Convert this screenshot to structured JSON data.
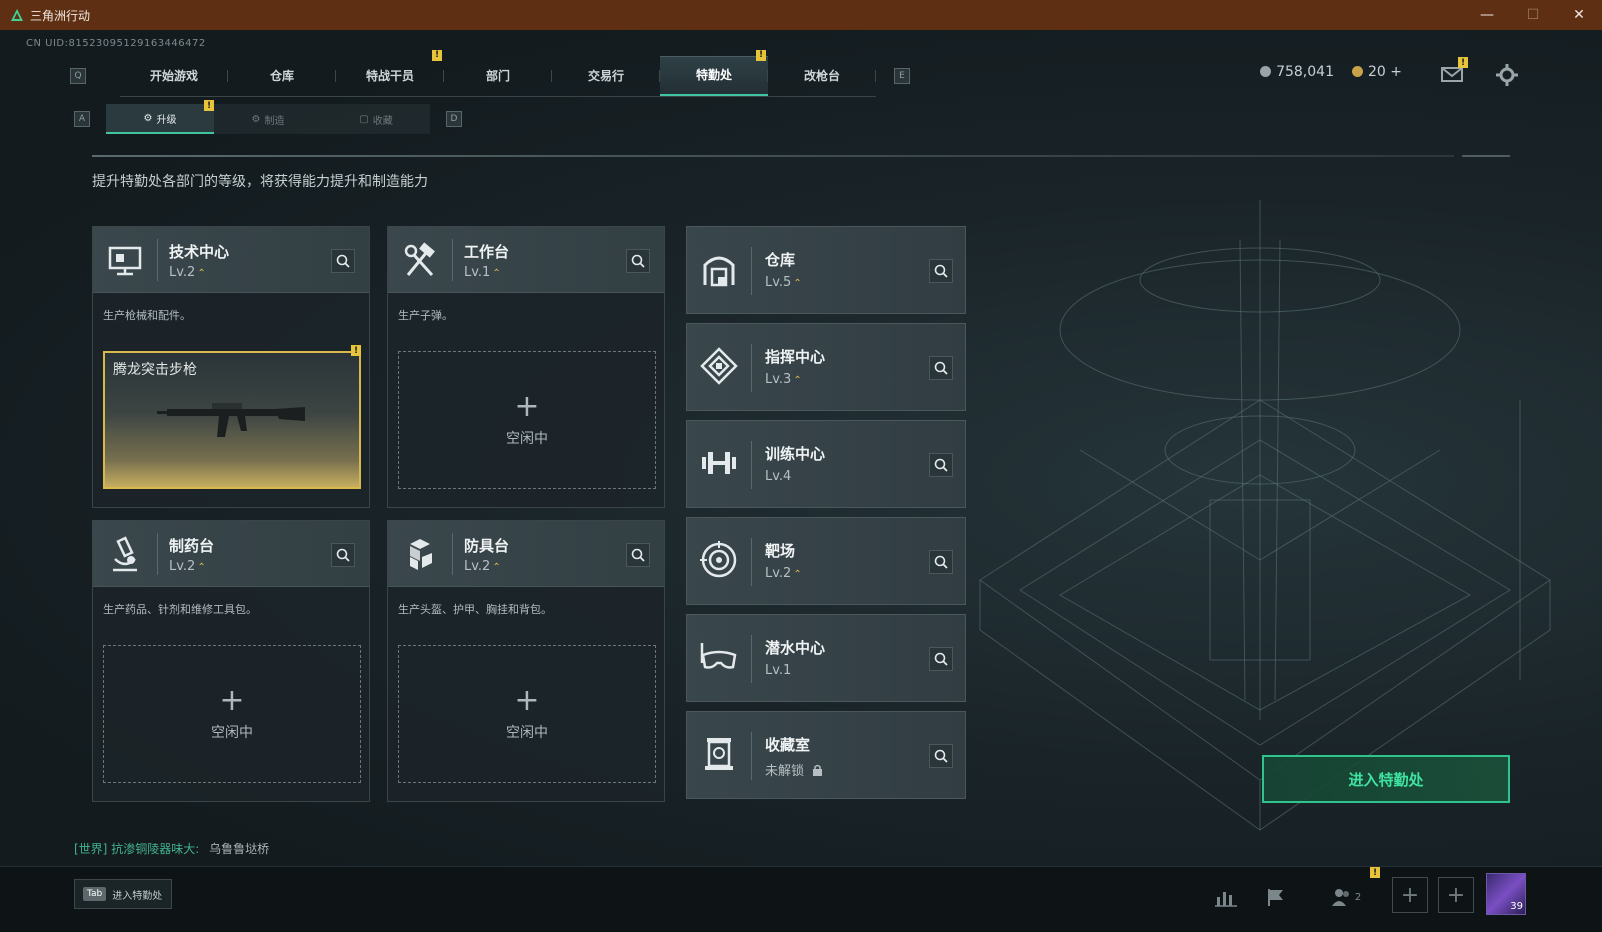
{
  "window": {
    "title": "三角洲行动",
    "controls": [
      "—",
      "☐",
      "✕"
    ]
  },
  "uid": "CN UID:81523095129163446472",
  "top_nav": {
    "left_key": "Q",
    "right_key": "E",
    "tabs": [
      {
        "label": "开始游戏",
        "badge": ""
      },
      {
        "label": "仓库",
        "badge": ""
      },
      {
        "label": "特战干员",
        "badge": "!"
      },
      {
        "label": "部门",
        "badge": ""
      },
      {
        "label": "交易行",
        "badge": ""
      },
      {
        "label": "特勤处",
        "badge": "!",
        "active": true
      },
      {
        "label": "改枪台",
        "badge": ""
      }
    ]
  },
  "currency": {
    "coins": "758,041",
    "gold": "20",
    "gold_plus": "+"
  },
  "sub_nav": {
    "left_key": "A",
    "right_key": "D",
    "tabs": [
      {
        "label": "升级",
        "active": true,
        "badge": "!"
      },
      {
        "label": "制造"
      },
      {
        "label": "收藏"
      }
    ]
  },
  "intro": "提升特勤处各部门的等级，将获得能力提升和制造能力",
  "departments_main": [
    {
      "name": "技术中心",
      "level": "Lv.2",
      "upgradable": true,
      "desc": "生产枪械和配件。",
      "slot": {
        "type": "item",
        "item_name": "腾龙突击步枪",
        "badge": "!"
      }
    },
    {
      "name": "工作台",
      "level": "Lv.1",
      "upgradable": true,
      "desc": "生产子弹。",
      "slot": {
        "type": "idle",
        "plus": "+",
        "label": "空闲中"
      }
    },
    {
      "name": "制药台",
      "level": "Lv.2",
      "upgradable": true,
      "desc": "生产药品、针剂和维修工具包。",
      "slot": {
        "type": "idle",
        "plus": "+",
        "label": "空闲中"
      }
    },
    {
      "name": "防具台",
      "level": "Lv.2",
      "upgradable": true,
      "desc": "生产头盔、护甲、胸挂和背包。",
      "slot": {
        "type": "idle",
        "plus": "+",
        "label": "空闲中"
      }
    }
  ],
  "departments_side": [
    {
      "name": "仓库",
      "level": "Lv.5",
      "upgradable": true,
      "icon": "warehouse-icon"
    },
    {
      "name": "指挥中心",
      "level": "Lv.3",
      "upgradable": true,
      "icon": "command-center-icon"
    },
    {
      "name": "训练中心",
      "level": "Lv.4",
      "upgradable": false,
      "icon": "dumbbell-icon"
    },
    {
      "name": "靶场",
      "level": "Lv.2",
      "upgradable": true,
      "icon": "target-icon"
    },
    {
      "name": "潜水中心",
      "level": "Lv.1",
      "upgradable": false,
      "icon": "diving-mask-icon"
    },
    {
      "name": "收藏室",
      "level": "未解锁",
      "upgradable": false,
      "locked": true,
      "icon": "collection-icon"
    }
  ],
  "enter_button": "进入特勤处",
  "chat": {
    "channel": "[世界]",
    "sender": "抗渗铜陵器味大:",
    "message": "乌鲁鲁垯桥"
  },
  "bottom": {
    "tab_key": "Tab",
    "tab_label": "进入特勤处",
    "friends_count": "2",
    "avatar_level": "39",
    "badge": "!"
  },
  "colors": {
    "accent": "#43c4a1",
    "badge": "#e8c43a",
    "enter": "#2fc48b",
    "titlebar": "#5e2f12"
  }
}
